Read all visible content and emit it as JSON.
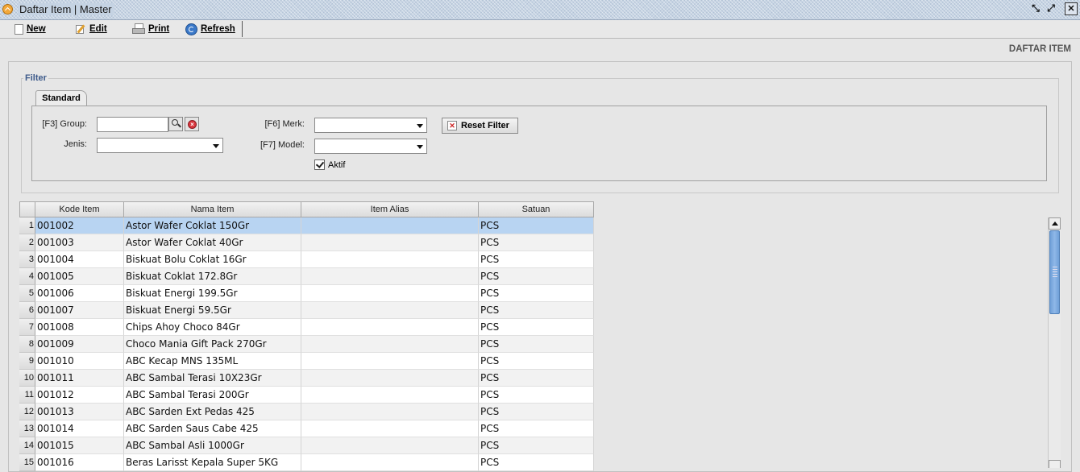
{
  "window": {
    "title": "Daftar Item | Master",
    "controls": [
      "restore-down-icon",
      "float-icon",
      "close-icon"
    ]
  },
  "toolbar": {
    "new_label": "New",
    "edit_label": "Edit",
    "print_label": "Print",
    "refresh_label": "Refresh"
  },
  "page": {
    "heading": "DAFTAR ITEM"
  },
  "filter": {
    "legend": "Filter",
    "tab_label": "Standard",
    "group_label": "[F3] Group:",
    "jenis_label": "Jenis:",
    "merk_label": "[F6] Merk:",
    "model_label": "[F7] Model:",
    "reset_label": "Reset Filter",
    "aktif_label": "Aktif",
    "aktif_checked": true,
    "group_value": "",
    "jenis_value": "",
    "merk_value": "",
    "model_value": ""
  },
  "grid": {
    "columns": [
      "Kode Item",
      "Nama Item",
      "Item Alias",
      "Satuan"
    ],
    "selected_row": 1,
    "rows": [
      {
        "no": "1",
        "kode": "001002",
        "nama": "Astor Wafer Coklat 150Gr",
        "alias": "",
        "satuan": "PCS"
      },
      {
        "no": "2",
        "kode": "001003",
        "nama": "Astor Wafer Coklat 40Gr",
        "alias": "",
        "satuan": "PCS"
      },
      {
        "no": "3",
        "kode": "001004",
        "nama": "Biskuat Bolu Coklat 16Gr",
        "alias": "",
        "satuan": "PCS"
      },
      {
        "no": "4",
        "kode": "001005",
        "nama": "Biskuat Coklat 172.8Gr",
        "alias": "",
        "satuan": "PCS"
      },
      {
        "no": "5",
        "kode": "001006",
        "nama": "Biskuat Energi 199.5Gr",
        "alias": "",
        "satuan": "PCS"
      },
      {
        "no": "6",
        "kode": "001007",
        "nama": "Biskuat Energi 59.5Gr",
        "alias": "",
        "satuan": "PCS"
      },
      {
        "no": "7",
        "kode": "001008",
        "nama": "Chips Ahoy Choco 84Gr",
        "alias": "",
        "satuan": "PCS"
      },
      {
        "no": "8",
        "kode": "001009",
        "nama": "Choco Mania Gift Pack 270Gr",
        "alias": "",
        "satuan": "PCS"
      },
      {
        "no": "9",
        "kode": "001010",
        "nama": "ABC Kecap MNS 135ML",
        "alias": "",
        "satuan": "PCS"
      },
      {
        "no": "10",
        "kode": "001011",
        "nama": "ABC Sambal Terasi 10X23Gr",
        "alias": "",
        "satuan": "PCS"
      },
      {
        "no": "11",
        "kode": "001012",
        "nama": "ABC Sambal Terasi 200Gr",
        "alias": "",
        "satuan": "PCS"
      },
      {
        "no": "12",
        "kode": "001013",
        "nama": "ABC Sarden Ext Pedas 425",
        "alias": "",
        "satuan": "PCS"
      },
      {
        "no": "13",
        "kode": "001014",
        "nama": "ABC Sarden Saus Cabe 425",
        "alias": "",
        "satuan": "PCS"
      },
      {
        "no": "14",
        "kode": "001015",
        "nama": "ABC Sambal Asli 1000Gr",
        "alias": "",
        "satuan": "PCS"
      },
      {
        "no": "15",
        "kode": "001016",
        "nama": "Beras Larisst Kepala Super 5KG",
        "alias": "",
        "satuan": "PCS"
      }
    ]
  }
}
